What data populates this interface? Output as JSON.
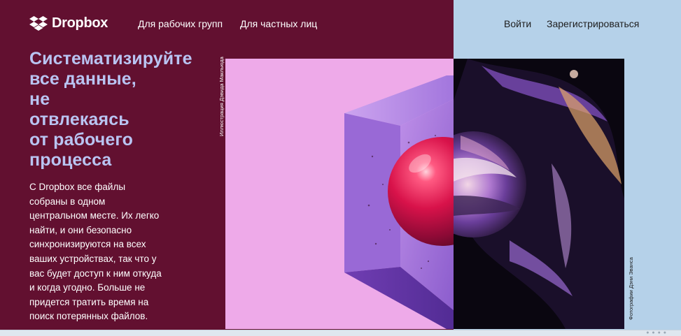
{
  "header": {
    "logo_text": "Dropbox",
    "nav_left": [
      "Для рабочих групп",
      "Для частных лиц"
    ],
    "nav_right": {
      "login": "Войти",
      "signup": "Зарегистрироваться"
    }
  },
  "hero": {
    "headline_lines": [
      "Систематизируйте",
      "все данные,",
      "не",
      "отвлекаясь",
      "от рабочего",
      "процесса"
    ],
    "body_lines": [
      "С Dropbox все файлы",
      "собраны в одном",
      "центральном месте. Их легко",
      "найти, и они безопасно",
      "синхронизируются на всех",
      "ваших устройствах, так что у",
      "вас будет доступ к ним откуда",
      "и когда угодно. Больше не",
      "придется тратить время на",
      "поиск потерянных файлов."
    ]
  },
  "captions": {
    "left": "Иллюстрация Дэвида Макльюда",
    "right": "Фотографии Дэни Эванса"
  },
  "colors": {
    "left_bg": "#621030",
    "right_bg": "#b5d1e9",
    "headline": "#b9c4f2",
    "art_pink": "#eeaae9",
    "sphere": "#c8184a"
  },
  "icons": {
    "logo": "dropbox-logo-icon"
  }
}
